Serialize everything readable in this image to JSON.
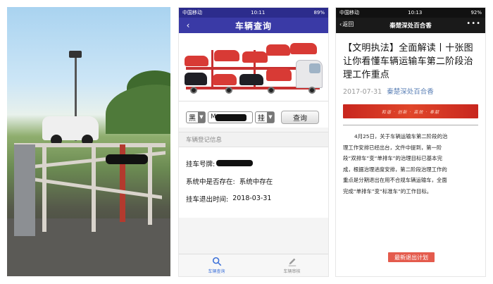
{
  "middle_phone": {
    "status": {
      "carrier": "中国移动",
      "time": "10:11",
      "battery": "89%"
    },
    "nav": {
      "title": "车辆查询",
      "back_icon": "chevron-left-icon"
    },
    "form": {
      "province": "黑",
      "plate_visible": "M",
      "plate_type": "挂",
      "query_label": "查询"
    },
    "section_title": "车辆登记信息",
    "rows": [
      {
        "label": "挂车号牌:",
        "value": ""
      },
      {
        "label": "系统中是否存在:",
        "value": "系统中存在"
      },
      {
        "label": "挂车退出时间:",
        "value": "2018-03-31"
      }
    ],
    "tabs": [
      {
        "label": "车辆查询",
        "icon": "search-icon",
        "active": true
      },
      {
        "label": "车辆审核",
        "icon": "pencil-icon",
        "active": false
      }
    ],
    "accent": "#3a3aa6"
  },
  "right_phone": {
    "status": {
      "carrier": "中国移动",
      "time": "10:13",
      "battery": "92%"
    },
    "nav": {
      "back_label": "返回",
      "title": "秦楚深处百合香",
      "more_icon": "more-dots-icon"
    },
    "article": {
      "title": "【文明执法】全面解读丨十张图让你看懂车辆运输车第二阶段治理工作重点",
      "date": "2017-07-31",
      "author": "秦楚深处百合香",
      "banner_text": "和谐 · 创新 · 高效 · 奉献",
      "paragraph_lines": [
        "4月25日，关于车辆运输车第二阶段的治",
        "理工作安排已经出台，文件中提到，第一阶",
        "段“双排车”变“单排车”的治理目标已基本完",
        "成，根据治理进度安排，第二阶段治理工作的",
        "重点是分期退出在用不合规车辆运输车，全面",
        "完成“单排车”变“标准车”的工作目标。"
      ],
      "button_label": "最新退出计划"
    },
    "accent": "#e45b4d"
  }
}
